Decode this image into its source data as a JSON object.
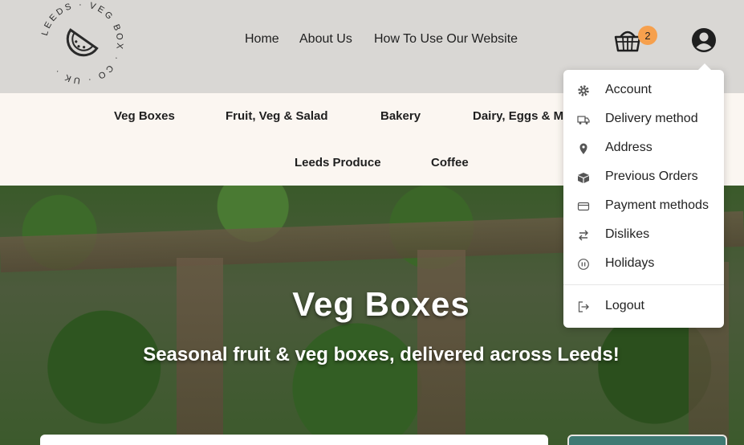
{
  "logo": {
    "ring_text": "LEEDS · VEG BOX · CO · UK ·"
  },
  "topnav": [
    {
      "label": "Home"
    },
    {
      "label": "About Us"
    },
    {
      "label": "How To Use Our Website"
    }
  ],
  "basket": {
    "count": "2"
  },
  "categories": [
    {
      "label": "Veg Boxes"
    },
    {
      "label": "Fruit, Veg & Salad"
    },
    {
      "label": "Bakery"
    },
    {
      "label": "Dairy, Eggs & M"
    },
    {
      "label": "Leeds Produce"
    },
    {
      "label": "Coffee"
    }
  ],
  "hero": {
    "title": "Veg Boxes",
    "subtitle": "Seasonal fruit & veg boxes, delivered across Leeds!"
  },
  "account_menu": [
    {
      "label": "Account",
      "icon": "gear-icon"
    },
    {
      "label": "Delivery method",
      "icon": "truck-icon"
    },
    {
      "label": "Address",
      "icon": "location-pin-icon"
    },
    {
      "label": "Previous Orders",
      "icon": "boxes-icon"
    },
    {
      "label": "Payment methods",
      "icon": "credit-card-icon"
    },
    {
      "label": "Dislikes",
      "icon": "swap-arrows-icon"
    },
    {
      "label": "Holidays",
      "icon": "pause-icon"
    },
    {
      "label": "Logout",
      "icon": "logout-icon"
    }
  ],
  "colors": {
    "header_bg": "#d9d7d4",
    "badge": "#f6a04d",
    "search_button": "#3f7a73",
    "category_bg": "#fbf6f1"
  }
}
